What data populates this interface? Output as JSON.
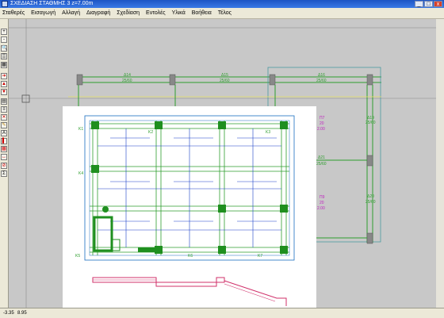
{
  "window": {
    "title": "ΣΧΕΔΙΑΣΗ ΣΤΑΘΜΗΣ 3   z=7.00m",
    "buttons": {
      "minimize": "_",
      "maximize": "□",
      "close": "x"
    }
  },
  "menu": {
    "items": [
      "Σταθερές",
      "Εισαγωγή",
      "Αλλαγή",
      "Διαγραφή",
      "Σχεδίαση",
      "Εντολές",
      "Υλικά",
      "Βοήθεια",
      "Τέλος"
    ]
  },
  "toolbar": {
    "tools": [
      {
        "icon": "plus-icon",
        "glyph": "+"
      },
      {
        "icon": "minus-icon",
        "glyph": "-"
      },
      {
        "icon": "zoom-icon",
        "glyph": "🔍"
      },
      {
        "icon": "pan-icon",
        "glyph": "▒"
      },
      {
        "icon": "grid-icon",
        "glyph": "▦"
      },
      {
        "icon": "arrow-right-icon",
        "glyph": "➜"
      },
      {
        "icon": "arrow-up-icon",
        "glyph": "▲"
      },
      {
        "icon": "arrow-down-icon",
        "glyph": "▼"
      },
      {
        "icon": "print-icon",
        "glyph": "▤"
      },
      {
        "icon": "layers-icon",
        "glyph": "≡"
      },
      {
        "icon": "delete-icon",
        "glyph": "✕"
      },
      {
        "icon": "edit-icon",
        "glyph": "✎"
      },
      {
        "icon": "text-icon",
        "glyph": "A"
      },
      {
        "icon": "column-icon",
        "glyph": "▌"
      },
      {
        "icon": "slab-icon",
        "glyph": "▦"
      },
      {
        "icon": "measure-icon",
        "glyph": "↔"
      },
      {
        "icon": "stop-icon",
        "glyph": "⊘"
      },
      {
        "icon": "sum-icon",
        "glyph": "Σ"
      }
    ]
  },
  "status": {
    "x": "-3.35",
    "y": "8.95"
  },
  "plan_labels": {
    "beams_top": [
      {
        "name": "Δ14",
        "size": "25/60"
      },
      {
        "name": "Δ15",
        "size": "25/60"
      },
      {
        "name": "Δ16",
        "size": "25/60"
      }
    ],
    "beams_right": [
      {
        "name": "Δ19",
        "size": "25/60"
      },
      {
        "name": "Δ21",
        "size": "25/60"
      },
      {
        "name": "Δ20",
        "size": "25/60"
      }
    ],
    "slabs": [
      {
        "name": "Π7",
        "thickness": "20",
        "load": "2.00"
      },
      {
        "name": "Π9",
        "thickness": "20",
        "load": "2.00"
      },
      {
        "name": "Π7",
        "thickness": "20",
        "load": "2.00"
      }
    ],
    "columns": [
      "K1",
      "K2",
      "K3",
      "K4",
      "K5",
      "K6",
      "K7"
    ]
  }
}
